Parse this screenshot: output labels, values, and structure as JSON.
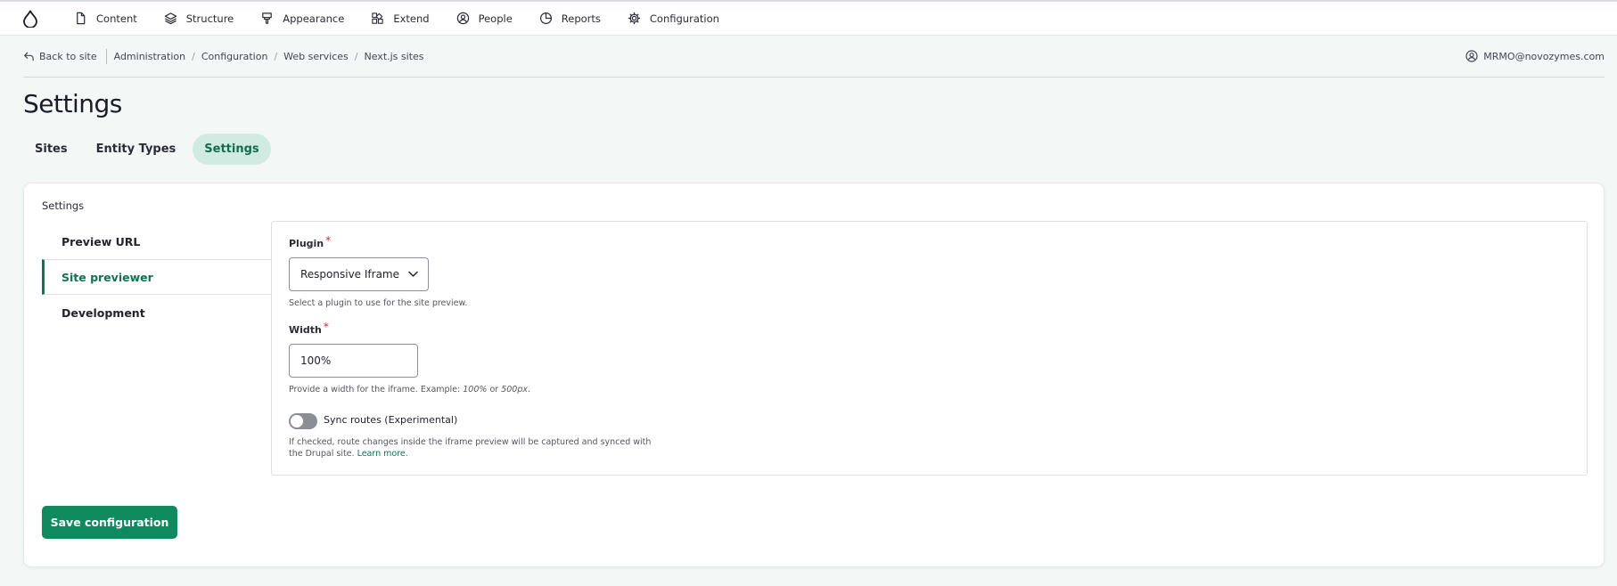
{
  "toolbar": {
    "logo_icon": "drupal-drop-icon",
    "items": [
      {
        "label": "Content",
        "icon": "document-icon"
      },
      {
        "label": "Structure",
        "icon": "layers-icon"
      },
      {
        "label": "Appearance",
        "icon": "brush-icon"
      },
      {
        "label": "Extend",
        "icon": "puzzle-icon"
      },
      {
        "label": "People",
        "icon": "person-circle-icon"
      },
      {
        "label": "Reports",
        "icon": "pie-chart-icon"
      },
      {
        "label": "Configuration",
        "icon": "gear-icon"
      }
    ]
  },
  "breadcrumb": {
    "back_label": "Back to site",
    "items": [
      "Administration",
      "Configuration",
      "Web services",
      "Next.js sites"
    ],
    "user": "MRMO@novozymes.com"
  },
  "page": {
    "title": "Settings",
    "tabs": [
      {
        "label": "Sites",
        "active": false
      },
      {
        "label": "Entity Types",
        "active": false
      },
      {
        "label": "Settings",
        "active": true
      }
    ]
  },
  "form": {
    "section_label": "Settings",
    "vertical_tabs": [
      {
        "label": "Preview URL",
        "active": false
      },
      {
        "label": "Site previewer",
        "active": true
      },
      {
        "label": "Development",
        "active": false
      }
    ],
    "plugin": {
      "label": "Plugin",
      "required_mark": "*",
      "value": "Responsive Iframe",
      "help": "Select a plugin to use for the site preview."
    },
    "width": {
      "label": "Width",
      "required_mark": "*",
      "value": "100%",
      "help_prefix": "Provide a width for the iframe. Example: ",
      "example1": "100%",
      "help_or": " or ",
      "example2": "500px",
      "help_suffix": "."
    },
    "sync_routes": {
      "label": "Sync routes (Experimental)",
      "checked": false,
      "help_line1": "If checked, route changes inside the iframe preview will be captured and synced with",
      "help_line2": "the Drupal site. ",
      "link": "Learn more."
    },
    "save_label": "Save configuration"
  },
  "colors": {
    "accent": "#0f8a5f",
    "accent_dark": "#0f7353",
    "active_tab_bg": "#d1ebe3",
    "background": "#f3f7f6"
  }
}
